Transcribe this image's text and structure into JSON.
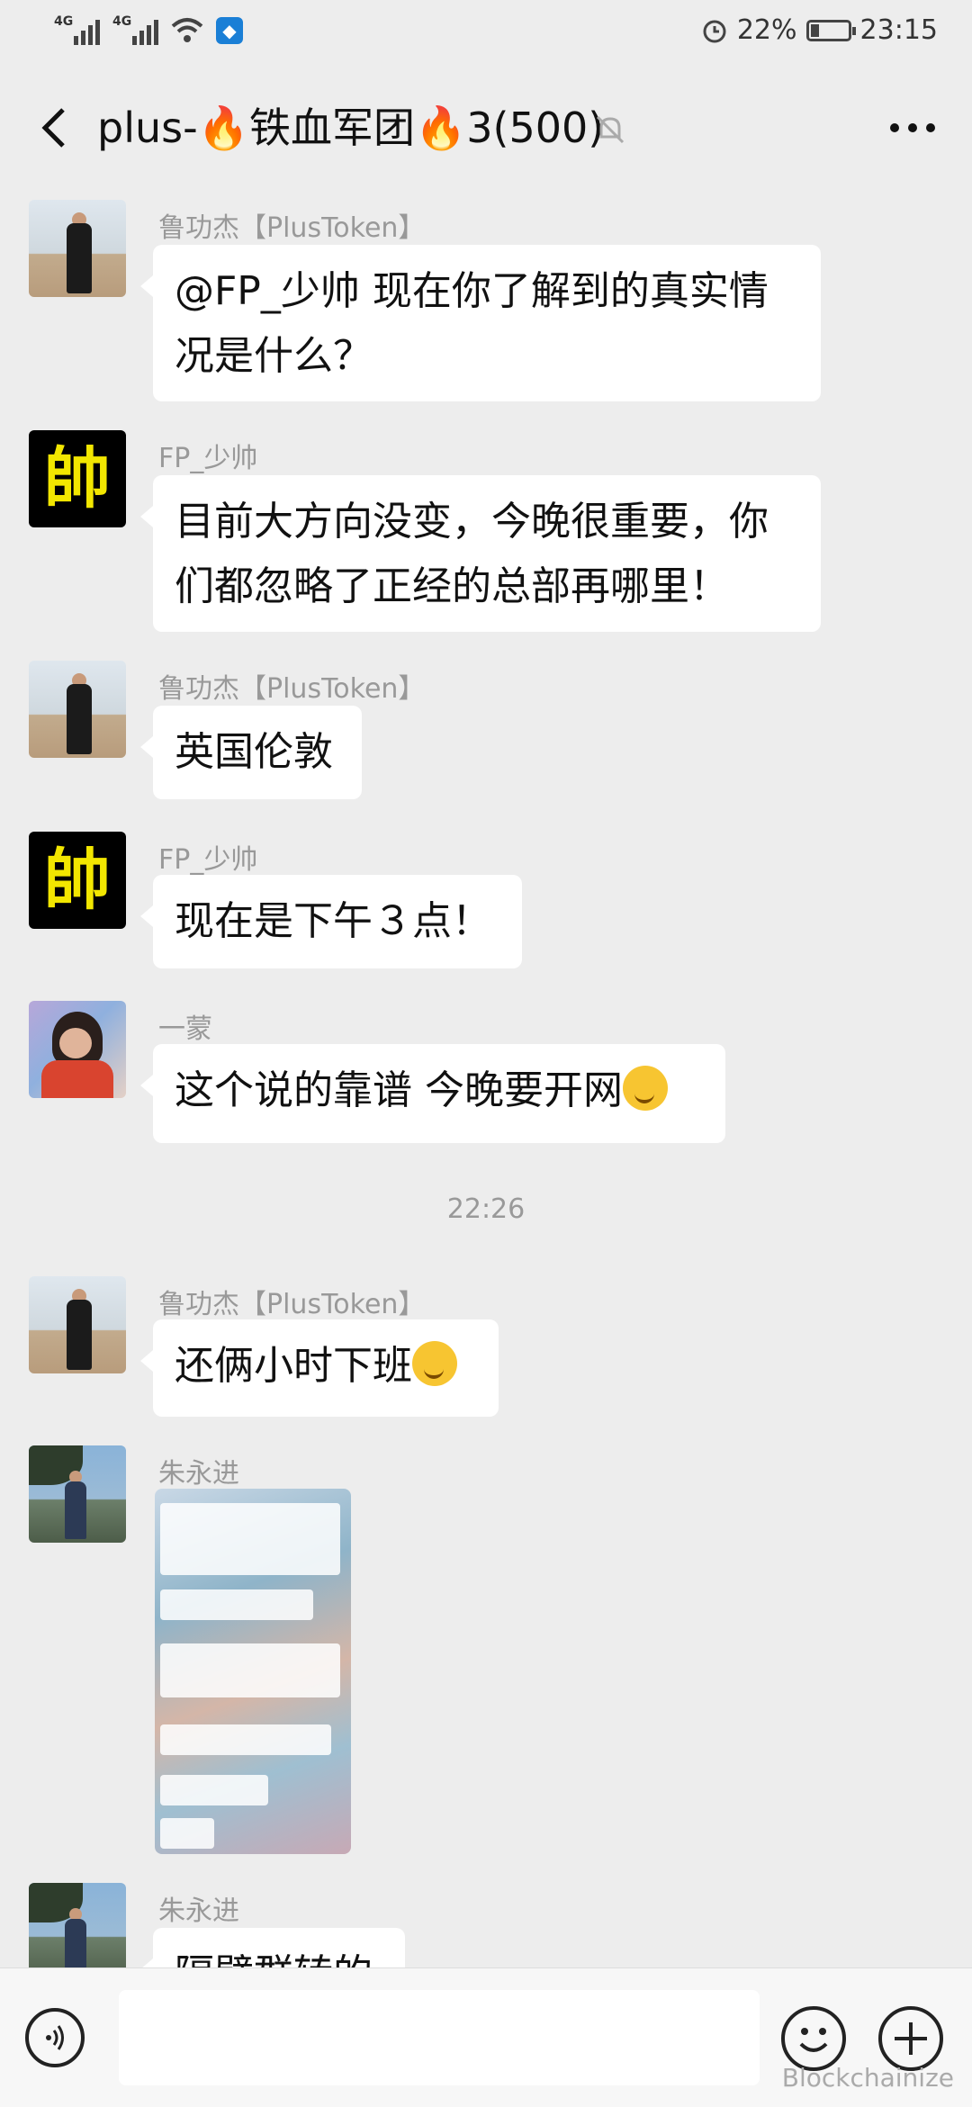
{
  "status_bar": {
    "net1": "4G",
    "net2": "4G",
    "battery": "22%",
    "battery_level": 0.22,
    "time": "23:15"
  },
  "header": {
    "title": "plus-🔥铁血军团🔥3(500)"
  },
  "messages": [
    {
      "sender": "鲁功杰【PlusToken】",
      "text": "@FP_少帅  现在你了解到的真实情况是什么？",
      "avatar": "avatar-lu"
    },
    {
      "sender": "FP_少帅",
      "text": "目前大方向没变，今晚很重要，你们都忽略了正经的总部再哪里！",
      "avatar": "avatar-fp",
      "avatar_char": "帥"
    },
    {
      "sender": "鲁功杰【PlusToken】",
      "text": "英国伦敦",
      "avatar": "avatar-lu"
    },
    {
      "sender": "FP_少帅",
      "text": "现在是下午３点！",
      "avatar": "avatar-fp",
      "avatar_char": "帥"
    },
    {
      "sender": "一蒙",
      "text": "这个说的靠谱  今晚要开网",
      "avatar": "avatar-yi"
    },
    {
      "sender": "鲁功杰【PlusToken】",
      "text": "还俩小时下班",
      "avatar": "avatar-lu"
    },
    {
      "sender": "朱永进",
      "text": "",
      "avatar": "avatar-zhu"
    },
    {
      "sender": "朱永进",
      "text": "隔壁群转的",
      "avatar": "avatar-zhu"
    }
  ],
  "timestamp": "22:26",
  "watermark": "Blockchainize",
  "icons": [
    "back-arrow-icon",
    "mute-bell-icon",
    "more-icon",
    "voice-icon",
    "emoji-icon",
    "plus-icon",
    "fire-icon"
  ]
}
